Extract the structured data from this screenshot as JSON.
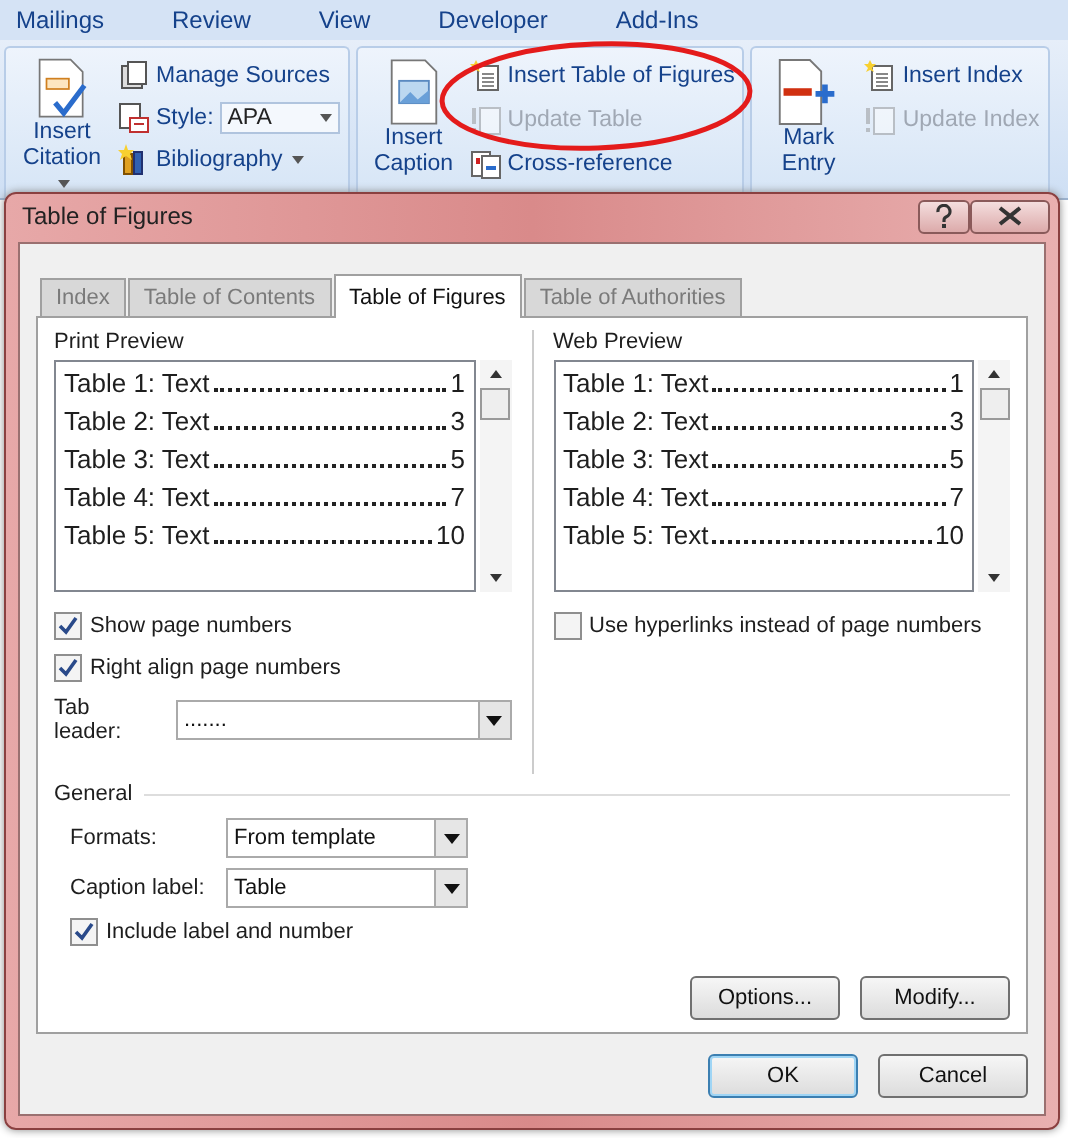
{
  "ribbon": {
    "tabs": [
      {
        "label": "Mailings"
      },
      {
        "label": "Review"
      },
      {
        "label": "View"
      },
      {
        "label": "Developer"
      },
      {
        "label": "Add-Ins"
      }
    ],
    "groups": [
      {
        "large": {
          "label": "Insert Citation",
          "dropdown": true
        },
        "items": [
          {
            "kind": "button",
            "label": "Manage Sources",
            "disabled": false,
            "dropdown": false
          },
          {
            "kind": "combo",
            "label": "Style:",
            "value": "APA"
          },
          {
            "kind": "button",
            "label": "Bibliography",
            "disabled": false,
            "dropdown": true
          }
        ]
      },
      {
        "large": {
          "label": "Insert Caption",
          "dropdown": false
        },
        "items": [
          {
            "kind": "button",
            "label": "Insert Table of Figures",
            "disabled": false,
            "dropdown": false
          },
          {
            "kind": "button",
            "label": "Update Table",
            "disabled": true,
            "dropdown": false
          },
          {
            "kind": "button",
            "label": "Cross-reference",
            "disabled": false,
            "dropdown": false
          }
        ]
      },
      {
        "large": {
          "label": "Mark Entry",
          "dropdown": false
        },
        "items": [
          {
            "kind": "button",
            "label": "Insert Index",
            "disabled": false,
            "dropdown": false
          },
          {
            "kind": "button",
            "label": "Update Index",
            "disabled": true,
            "dropdown": false
          }
        ]
      }
    ]
  },
  "dialog": {
    "title": "Table of Figures",
    "tabs": [
      {
        "label": "Index",
        "selected": false
      },
      {
        "label": "Table of Contents",
        "selected": false
      },
      {
        "label": "Table of Figures",
        "selected": true
      },
      {
        "label": "Table of Authorities",
        "selected": false
      }
    ],
    "print_preview": {
      "label": "Print Preview",
      "entries": [
        {
          "caption": "Table 1: Text",
          "page": "1"
        },
        {
          "caption": "Table 2: Text",
          "page": "3"
        },
        {
          "caption": "Table 3: Text",
          "page": "5"
        },
        {
          "caption": "Table 4: Text",
          "page": "7"
        },
        {
          "caption": "Table 5: Text",
          "page": "10"
        }
      ]
    },
    "web_preview": {
      "label": "Web Preview",
      "entries": [
        {
          "caption": "Table 1: Text",
          "page": "1"
        },
        {
          "caption": "Table 2: Text",
          "page": "3"
        },
        {
          "caption": "Table 3: Text",
          "page": "5"
        },
        {
          "caption": "Table 4: Text",
          "page": "7"
        },
        {
          "caption": "Table 5: Text",
          "page": "10"
        }
      ]
    },
    "left_options": [
      {
        "label": "Show page numbers",
        "checked": true
      },
      {
        "label": "Right align page numbers",
        "checked": true
      }
    ],
    "tab_leader": {
      "label": "Tab leader:",
      "value": "......."
    },
    "right_options": [
      {
        "label": "Use hyperlinks instead of page numbers",
        "checked": false
      }
    ],
    "general": {
      "label": "General",
      "fields": [
        {
          "label": "Formats:",
          "value": "From template"
        },
        {
          "label": "Caption label:",
          "value": "Table"
        }
      ],
      "options": [
        {
          "label": "Include label and number",
          "checked": true
        }
      ]
    },
    "page_buttons": [
      {
        "label": "Options..."
      },
      {
        "label": "Modify..."
      }
    ],
    "buttons": [
      {
        "label": "OK",
        "default": true
      },
      {
        "label": "Cancel",
        "default": false
      }
    ]
  }
}
